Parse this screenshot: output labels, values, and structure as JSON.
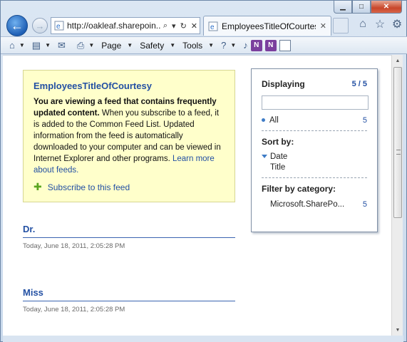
{
  "browser": {
    "address_url": "http://oakleaf.sharepoin...",
    "tab_title": "EmployeesTitleOfCourtesy",
    "command_bar": {
      "page_label": "Page",
      "safety_label": "Safety",
      "tools_label": "Tools"
    }
  },
  "feed": {
    "title": "EmployeesTitleOfCourtesy",
    "intro_bold": "You are viewing a feed that contains frequently updated content.",
    "intro_text": " When you subscribe to a feed, it is added to the Common Feed List. Updated information from the feed is automatically downloaded to your computer and can be viewed in Internet Explorer and other programs. ",
    "learn_more": "Learn more about feeds.",
    "subscribe_label": "Subscribe to this feed"
  },
  "entries": [
    {
      "title": "Dr.",
      "date": "Today, June 18, 2011, 2:05:28 PM"
    },
    {
      "title": "Miss",
      "date": "Today, June 18, 2011, 2:05:28 PM"
    }
  ],
  "panel": {
    "displaying_label": "Displaying",
    "displaying_count": "5 / 5",
    "all_label": "All",
    "all_count": "5",
    "sort_label": "Sort by:",
    "sort_date": "Date",
    "sort_title": "Title",
    "filter_label": "Filter by category:",
    "category_name": "Microsoft.SharePo...",
    "category_count": "5"
  }
}
